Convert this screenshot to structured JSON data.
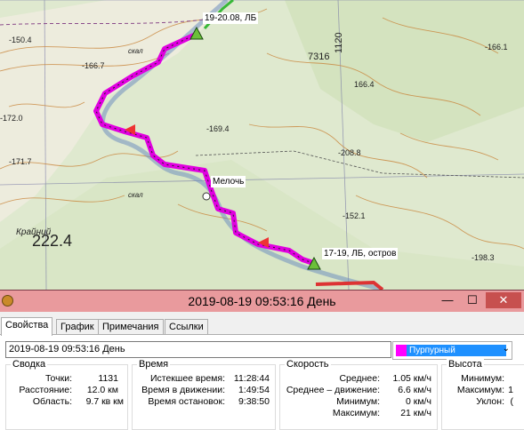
{
  "map": {
    "waypoints": [
      {
        "label": "19-20.08, ЛБ"
      },
      {
        "label": "Мелочь"
      },
      {
        "label": "17-19, ЛБ, остров"
      }
    ],
    "labels": {
      "elev_1": "-150.4",
      "elev_2": "-166.7",
      "elev_3": "-166.1",
      "elev_4": "166.4",
      "elev_5": "-172.0",
      "elev_6": "-171.7",
      "elev_7": "-208.8",
      "elev_8": "-169.4",
      "elev_9": "-152.1",
      "elev_10": "-198.3",
      "big_elev": "222.4",
      "sheet": "7316",
      "grid": "1120",
      "village": "Крайний",
      "creek": "Мелочь",
      "rocky1": "скал",
      "rocky2": "скал"
    }
  },
  "window": {
    "title": "2019-08-19 09:53:16 День",
    "minimize": "—",
    "maximize": "☐",
    "close": "✕"
  },
  "tabs": [
    "Свойства",
    "График",
    "Примечания",
    "Ссылки"
  ],
  "name_value": "2019-08-19 09:53:16 День",
  "color": {
    "label": "Пурпурный",
    "swatch": "#ff00ff",
    "highlight": "#1e90ff"
  },
  "summary": {
    "title": "Сводка",
    "rows": [
      {
        "label": "Точки:",
        "value": "1131"
      },
      {
        "label": "Расстояние:",
        "value": "12.0 км"
      },
      {
        "label": "Область:",
        "value": "9.7 кв км"
      }
    ]
  },
  "time": {
    "title": "Время",
    "rows": [
      {
        "label": "Истекшее время:",
        "value": "11:28:44"
      },
      {
        "label": "Время в движении:",
        "value": "1:49:54"
      },
      {
        "label": "Время остановок:",
        "value": "9:38:50"
      }
    ]
  },
  "speed": {
    "title": "Скорость",
    "rows": [
      {
        "label": "Среднее:",
        "value": "1.05 км/ч"
      },
      {
        "label": "Среднее – движение:",
        "value": "6.6 км/ч"
      },
      {
        "label": "Минимум:",
        "value": "0 км/ч"
      },
      {
        "label": "Максимум:",
        "value": "21 км/ч"
      }
    ]
  },
  "altitude": {
    "title": "Высота",
    "rows": [
      {
        "label": "Минимум:",
        "value": ""
      },
      {
        "label": "Максимум:",
        "value": "1"
      },
      {
        "label": "Уклон:",
        "value": "("
      }
    ]
  }
}
